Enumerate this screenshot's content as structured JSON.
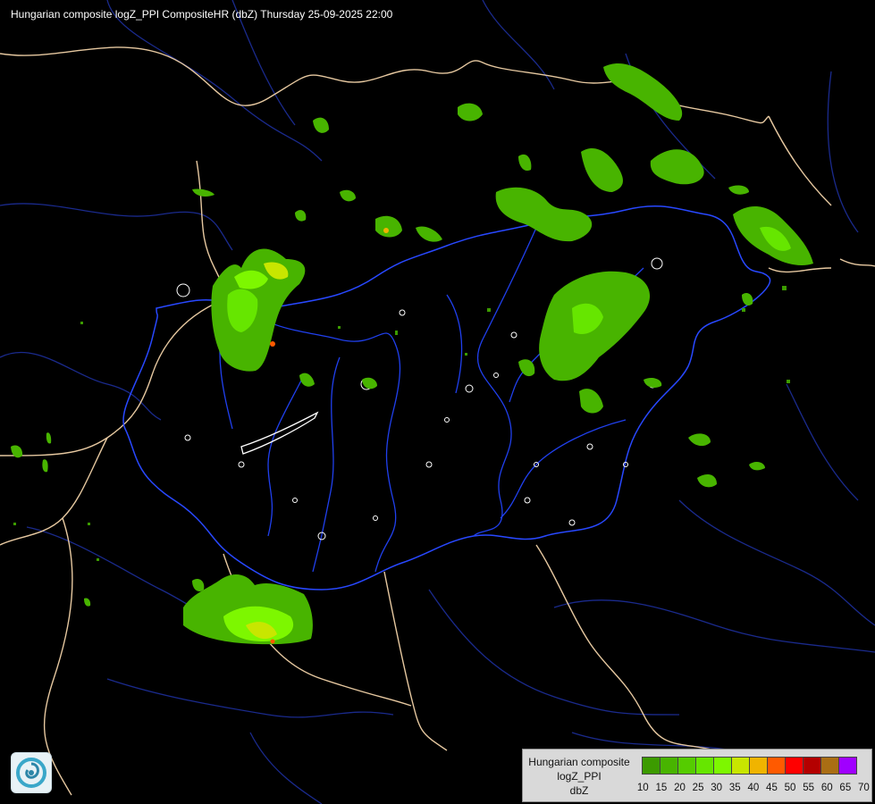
{
  "title": "Hungarian composite logZ_PPI CompositeHR (dbZ) Thursday 25-09-2025 22:00",
  "legend": {
    "line1": "Hungarian composite",
    "line2": "logZ_PPI",
    "line3": "dbZ",
    "scale": [
      {
        "value": "10",
        "color": "#3c9b00"
      },
      {
        "value": "15",
        "color": "#48b400"
      },
      {
        "value": "20",
        "color": "#55cc00"
      },
      {
        "value": "25",
        "color": "#66e600"
      },
      {
        "value": "30",
        "color": "#7df700"
      },
      {
        "value": "35",
        "color": "#c8e600"
      },
      {
        "value": "40",
        "color": "#f0b400"
      },
      {
        "value": "45",
        "color": "#ff5a00"
      },
      {
        "value": "50",
        "color": "#ff0000"
      },
      {
        "value": "55",
        "color": "#b40000"
      },
      {
        "value": "60",
        "color": "#aa6e14"
      },
      {
        "value": "65",
        "color": "#a000ff"
      },
      {
        "value": "70",
        "color": "#a0a0ff"
      }
    ],
    "last_tick": "70"
  },
  "colors": {
    "background": "#000000",
    "border": "#e6c8a0",
    "rivers": "#1e3cff",
    "lakes": "#ffffff"
  },
  "logo_icon": "weather-service-logo-icon"
}
